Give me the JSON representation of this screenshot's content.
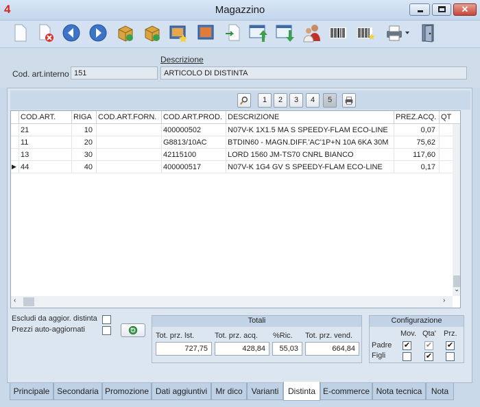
{
  "window": {
    "logo": "4",
    "title": "Magazzino",
    "close_glyph": "✕"
  },
  "toolbar": {
    "icons": [
      "new-document-icon",
      "delete-document-icon",
      "back-arrow-icon",
      "forward-arrow-icon",
      "box-add-icon",
      "box-refresh-icon",
      "picture-star-icon",
      "picture-icon",
      "document-import-icon",
      "window-upload-icon",
      "window-download-icon",
      "users-icon",
      "barcode-icon",
      "barcode-star-icon",
      "printer-icon",
      "exit-door-icon"
    ]
  },
  "header": {
    "code_label": "Cod. art.interno",
    "code_value": "151",
    "desc_label": "Descrizione",
    "desc_value": "ARTICOLO DI DISTINTA"
  },
  "pager": {
    "pages": [
      "1",
      "2",
      "3",
      "4",
      "5"
    ],
    "active": "5"
  },
  "grid": {
    "columns": [
      "COD.ART.",
      "RIGA",
      "COD.ART.FORN.",
      "COD.ART.PROD.",
      "DESCRIZIONE",
      "PREZ.ACQ.",
      "QT"
    ],
    "rows": [
      {
        "indicator": "",
        "cod_art": "21",
        "riga": "10",
        "cod_forn": "",
        "cod_prod": "400000502",
        "descrizione": "N07V-K 1X1.5 MA S SPEEDY-FLAM ECO-LINE",
        "prez_acq": "0,07"
      },
      {
        "indicator": "",
        "cod_art": "11",
        "riga": "20",
        "cod_forn": "",
        "cod_prod": "G8813/10AC",
        "descrizione": "BTDIN60 - MAGN.DIFF.'AC'1P+N 10A 6KA 30M",
        "prez_acq": "75,62"
      },
      {
        "indicator": "",
        "cod_art": "13",
        "riga": "30",
        "cod_forn": "",
        "cod_prod": "42115100",
        "descrizione": "LORD 1560 JM-TS70 CNRL BIANCO",
        "prez_acq": "117,60"
      },
      {
        "indicator": "▶",
        "cod_art": "44",
        "riga": "40",
        "cod_forn": "",
        "cod_prod": "400000517",
        "descrizione": "N07V-K 1G4 GV S SPEEDY-FLAM ECO-LINE",
        "prez_acq": "0,17"
      }
    ]
  },
  "options": {
    "escludi_label": "Escludi da aggior. distinta",
    "escludi_checked": false,
    "prezzi_label": "Prezzi auto-aggiornati",
    "prezzi_checked": false
  },
  "totali": {
    "title": "Totali",
    "labels": [
      "Tot. prz. lst.",
      "Tot. prz. acq.",
      "%Ric.",
      "Tot. prz. vend."
    ],
    "values": [
      "727,75",
      "428,84",
      "55,03",
      "664,84"
    ]
  },
  "configurazione": {
    "title": "Configurazione",
    "columns": [
      "Mov.",
      "Qta'",
      "Prz."
    ],
    "rows": [
      {
        "label": "Padre",
        "mov": "✔",
        "qta": "✔",
        "prz": "✔"
      },
      {
        "label": "Figli",
        "mov": "",
        "qta": "✔",
        "prz": ""
      }
    ]
  },
  "tabs": [
    "Principale",
    "Secondaria",
    "Promozione",
    "Dati aggiuntivi",
    "Mr dico",
    "Varianti",
    "Distinta",
    "E-commerce",
    "Nota tecnica",
    "Nota"
  ],
  "active_tab": "Distinta"
}
